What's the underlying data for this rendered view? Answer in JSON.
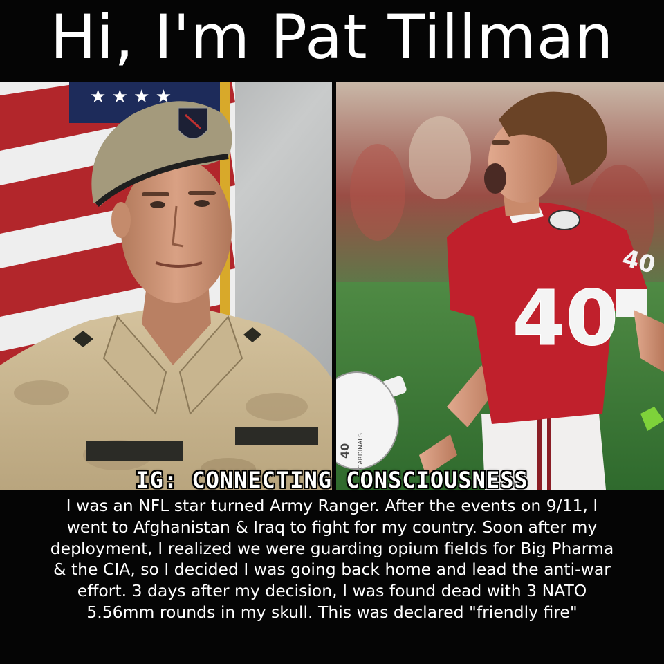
{
  "header": {
    "title": "Hi, I'm Pat Tillman"
  },
  "photos": {
    "left": {
      "subject": "soldier-portrait"
    },
    "right": {
      "subject": "football-player",
      "jersey_number": "40",
      "sleeve_number": "40",
      "helmet_text": "CARDINALS",
      "helmet_number": "40"
    }
  },
  "watermark": {
    "text": "IG: CONNECTING CONSCIOUSNESS"
  },
  "caption": {
    "lines": [
      "I was an NFL star turned Army Ranger. After the events on 9/11, I",
      "went to Afghanistan & Iraq to fight for my country. Soon after my",
      "deployment, I realized we were guarding opium fields for Big Pharma",
      "& the CIA, so I decided I was going back home and lead the anti-war",
      "effort. 3 days after my decision, I was found dead with 3 NATO",
      "5.56mm rounds in my skull. This was declared \"friendly fire\""
    ]
  },
  "colors": {
    "background": "#050505",
    "text": "#ffffff",
    "jersey_red": "#c0202c",
    "grass": "#3f7a3a",
    "beret": "#a49a7c",
    "camo": "#cbb893"
  }
}
